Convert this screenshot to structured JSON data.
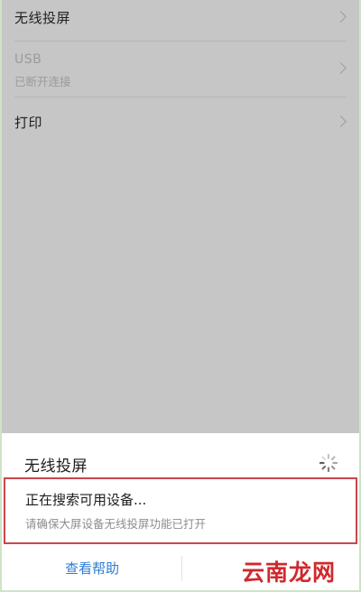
{
  "settings": {
    "items": [
      {
        "title": "无线投屏"
      },
      {
        "title": "USB",
        "subtitle": "已断开连接"
      },
      {
        "title": "打印"
      }
    ]
  },
  "sheet": {
    "title": "无线投屏",
    "status": "正在搜索可用设备...",
    "hint": "请确保大屏设备无线投屏功能已打开",
    "help_label": "查看帮助"
  },
  "watermark": "云南龙网",
  "colors": {
    "accent": "#2e7cd4",
    "highlight_border": "#c9474b",
    "watermark": "#d0282c",
    "dimmed_background": "#c6c6c6"
  },
  "icons": {
    "chevron": "chevron-right-icon",
    "spinner": "loading-spinner-icon"
  }
}
